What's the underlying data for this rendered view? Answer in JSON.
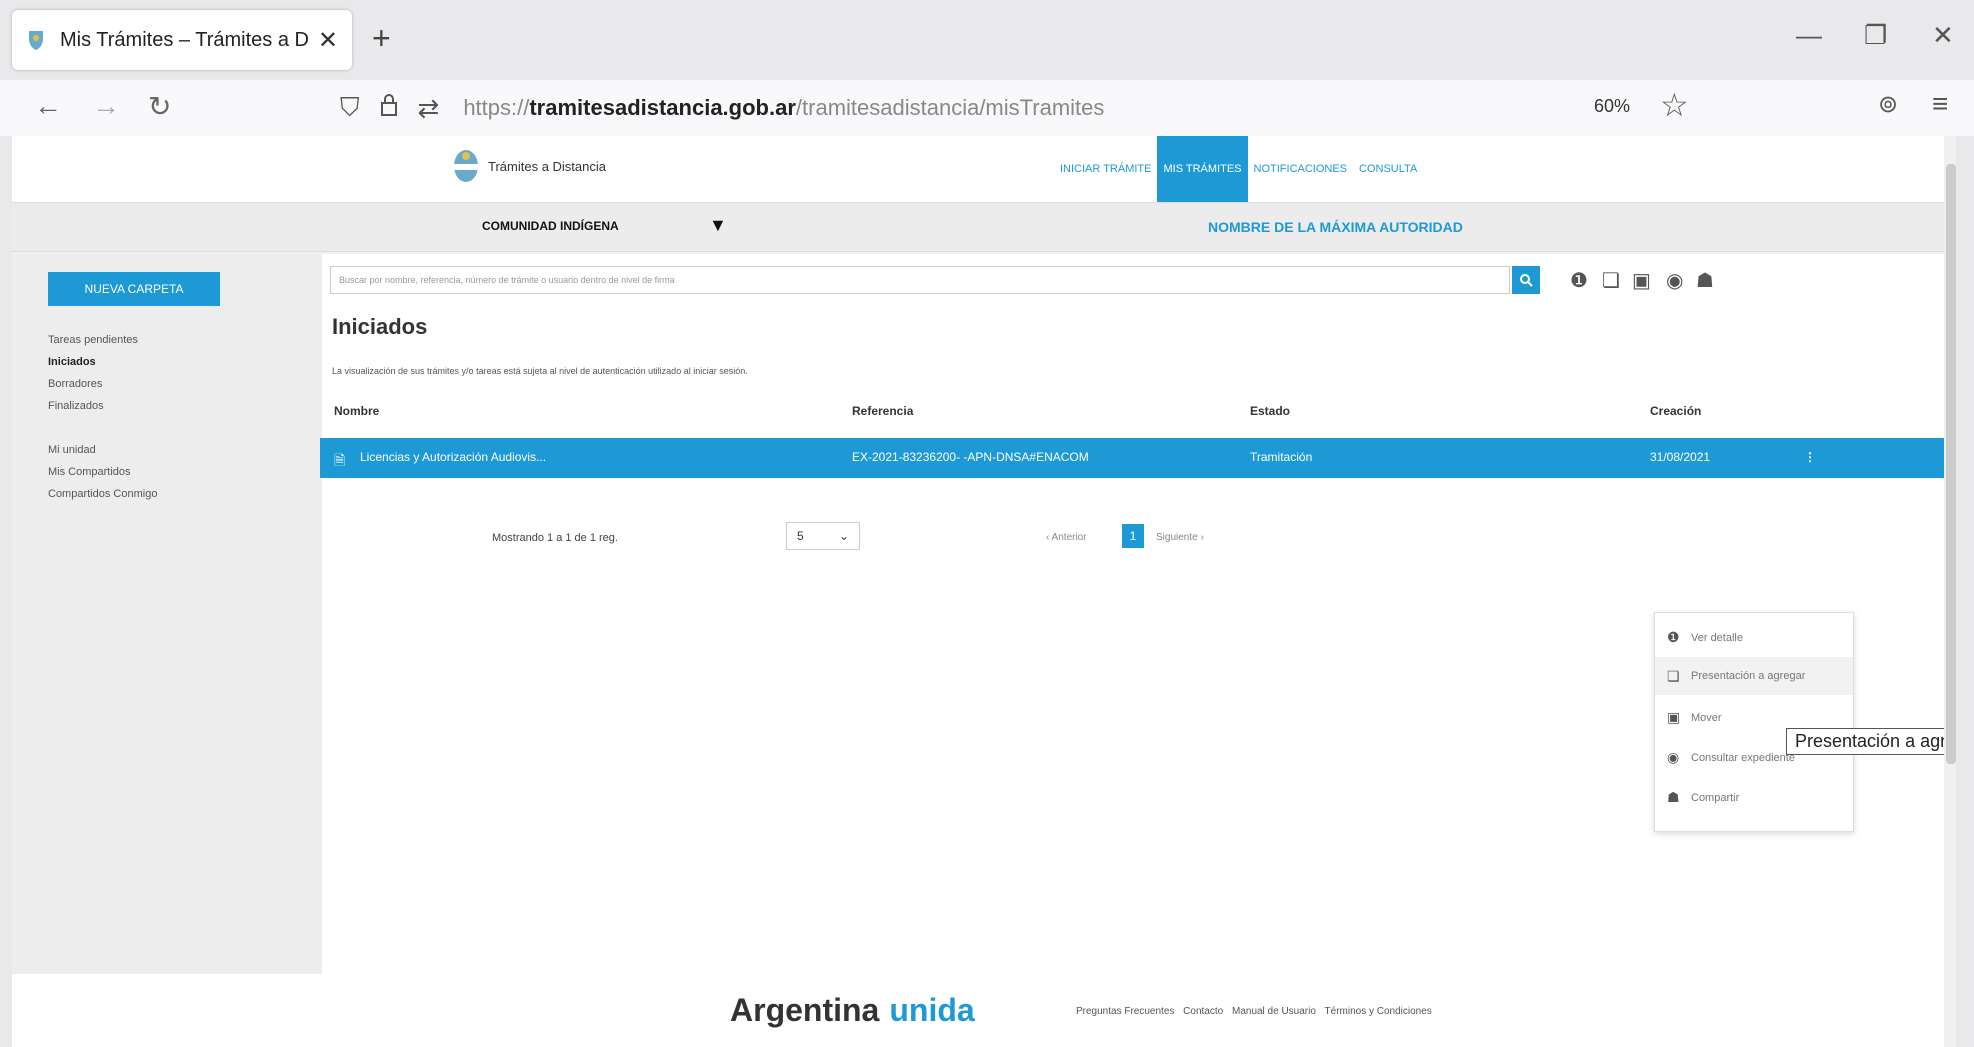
{
  "browser": {
    "tab_title": "Mis Trámites – Trámites a Distancia",
    "new_tab": "+",
    "tab_close": "✕",
    "url_prefix": "https://",
    "url_domain": "tramitesadistancia.gob.ar",
    "url_path": "/tramitesadistancia/misTramites",
    "zoom": "60%",
    "minimize": "—",
    "restore": "❐",
    "close": "✕"
  },
  "site": {
    "logo_text": "Trámites a Distancia",
    "nav": [
      {
        "label": "INICIAR TRÁMITE",
        "active": false
      },
      {
        "label": "MIS TRÁMITES",
        "active": true
      },
      {
        "label": "NOTIFICACIONES",
        "active": false
      },
      {
        "label": "CONSULTA",
        "active": false
      }
    ],
    "community": "COMUNIDAD INDÍGENA",
    "authority": "NOMBRE DE LA MÁXIMA AUTORIDAD"
  },
  "sidebar": {
    "new_folder_label": "NUEVA CARPETA",
    "items": [
      {
        "label": "Tareas pendientes"
      },
      {
        "label": "Iniciados",
        "active": true
      },
      {
        "label": "Borradores"
      },
      {
        "label": "Finalizados"
      },
      {
        "label": "Mi unidad"
      },
      {
        "label": "Mis Compartidos"
      },
      {
        "label": "Compartidos Conmigo"
      }
    ]
  },
  "main": {
    "search_placeholder": "Buscar por nombre, referencia, número de trámite o usuario dentro de nivel de firma",
    "heading": "Iniciados",
    "info_text": "La visualización de sus trámites y/o tareas está sujeta al nivel de autenticación utilizado al iniciar sesión.",
    "columns": [
      "Nombre",
      "Referencia",
      "Estado",
      "Creación"
    ],
    "row": {
      "name": "Licencias y Autorización Audiovis...",
      "reference": "EX-2021-83236200- -APN-DNSA#ENACOM",
      "status": "Tramitación",
      "created": "31/08/2021"
    },
    "pager_text": "Mostrando 1 a 1 de 1 reg.",
    "page_size": "5",
    "prev_label": "‹ Anterior",
    "current_page": "1",
    "next_label": "Siguiente ›"
  },
  "dropdown": {
    "items": [
      {
        "icon": "info-icon",
        "label": "Ver detalle"
      },
      {
        "icon": "document-add-icon",
        "label": "Presentación a agregar"
      },
      {
        "icon": "folder-icon",
        "label": "Mover"
      },
      {
        "icon": "eye-icon",
        "label": "Consultar expediente"
      },
      {
        "icon": "user-share-icon",
        "label": "Compartir"
      }
    ],
    "tooltip": "Presentación a agregar"
  },
  "footer": {
    "brand_main": "Argentina",
    "brand_accent": "unida",
    "links": [
      "Preguntas Frecuentes",
      "Contacto",
      "Manual de Usuario",
      "Términos y Condiciones"
    ]
  },
  "colors": {
    "accent": "#1d9ad6"
  }
}
